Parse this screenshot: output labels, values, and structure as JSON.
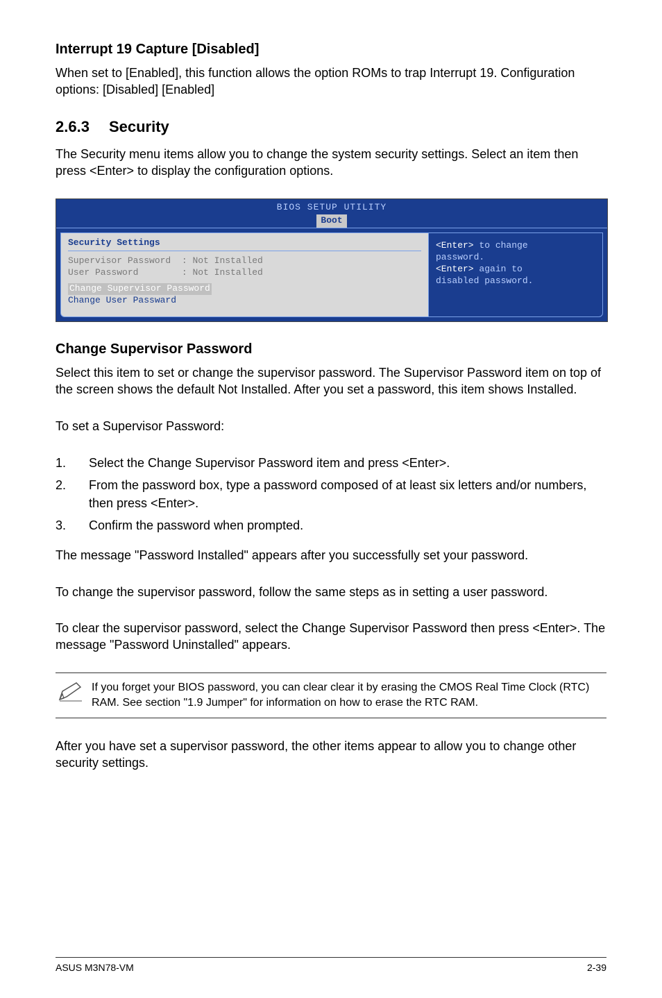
{
  "sec1": {
    "heading": "Interrupt 19 Capture [Disabled]",
    "body": "When set to [Enabled], this function allows the option ROMs to trap Interrupt 19. Configuration options: [Disabled] [Enabled]"
  },
  "sec2": {
    "number": "2.6.3",
    "title": "Security",
    "intro": "The Security menu items allow you to change the system security settings. Select an item then press <Enter> to display the configuration options."
  },
  "bios": {
    "title": "BIOS SETUP UTILITY",
    "tab": "Boot",
    "left_heading": "Security Settings",
    "row1_label": "Supervisor Password",
    "row1_value": ": Not Installed",
    "row2_label": "User Password",
    "row2_value": ": Not Installed",
    "row3": "Change Supervisor Password",
    "row4": "Change User Passward",
    "right_line1a": "<Enter>",
    "right_line1b": " to change",
    "right_line2": "password.",
    "right_line3a": "<Enter>",
    "right_line3b": " again to",
    "right_line4": "disabled password."
  },
  "sec3": {
    "heading": "Change Supervisor Password",
    "p1": "Select this item to set or change the supervisor password. The Supervisor Password item on top of the screen shows the default Not Installed. After you set a password, this item shows Installed.",
    "p2": "To set a Supervisor Password:",
    "li1": "Select the Change Supervisor Password item and press <Enter>.",
    "li2": "From the password box, type a password composed of at least six letters and/or numbers, then press <Enter>.",
    "li3": "Confirm the password when prompted.",
    "p3": "The message \"Password Installed\" appears after you successfully set your password.",
    "p4": "To change the supervisor password, follow the same steps as in setting a user password.",
    "p5": "To clear the supervisor password, select the Change Supervisor Password then press <Enter>. The message \"Password Uninstalled\" appears.",
    "note": "If you forget your BIOS password, you can clear clear it by erasing the CMOS Real Time Clock (RTC) RAM. See section \"1.9 Jumper\" for information on how to erase the RTC RAM.",
    "p6": "After you have set a supervisor password, the other items appear to allow you to change other security settings."
  },
  "footer": {
    "left": "ASUS M3N78-VM",
    "right": "2-39"
  },
  "list_numbers": {
    "n1": "1.",
    "n2": "2.",
    "n3": "3."
  }
}
